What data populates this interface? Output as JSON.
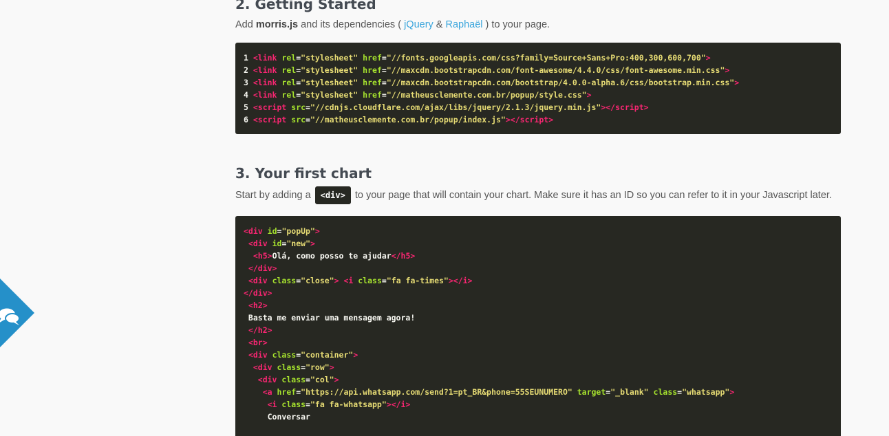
{
  "getting_started": {
    "heading": "2. Getting Started",
    "intro_pre": "Add ",
    "intro_bold": "morris.js",
    "intro_mid": " and its dependencies ( ",
    "link_jquery": "jQuery",
    "amp": " & ",
    "link_raphael": "Raphaël",
    "intro_post": " ) to your page.",
    "code_lines": [
      {
        "n": "1",
        "parts": [
          [
            "tag",
            "<link"
          ],
          [
            "txt",
            " "
          ],
          [
            "attr",
            "rel"
          ],
          [
            "txt",
            "="
          ],
          [
            "str",
            "\"stylesheet\""
          ],
          [
            "txt",
            " "
          ],
          [
            "attr",
            "href"
          ],
          [
            "txt",
            "="
          ],
          [
            "str",
            "\"//fonts.googleapis.com/css?family=Source+Sans+Pro:400,300,600,700\""
          ],
          [
            "tag",
            ">"
          ]
        ]
      },
      {
        "n": "2",
        "parts": [
          [
            "tag",
            "<link"
          ],
          [
            "txt",
            " "
          ],
          [
            "attr",
            "rel"
          ],
          [
            "txt",
            "="
          ],
          [
            "str",
            "\"stylesheet\""
          ],
          [
            "txt",
            " "
          ],
          [
            "attr",
            "href"
          ],
          [
            "txt",
            "="
          ],
          [
            "str",
            "\"//maxcdn.bootstrapcdn.com/font-awesome/4.4.0/css/font-awesome.min.css\""
          ],
          [
            "tag",
            ">"
          ]
        ]
      },
      {
        "n": "3",
        "parts": [
          [
            "tag",
            "<link"
          ],
          [
            "txt",
            " "
          ],
          [
            "attr",
            "rel"
          ],
          [
            "txt",
            "="
          ],
          [
            "str",
            "\"stylesheet\""
          ],
          [
            "txt",
            " "
          ],
          [
            "attr",
            "href"
          ],
          [
            "txt",
            "="
          ],
          [
            "str",
            "\"//maxcdn.bootstrapcdn.com/bootstrap/4.0.0-alpha.6/css/bootstrap.min.css\""
          ],
          [
            "tag",
            ">"
          ]
        ]
      },
      {
        "n": "4",
        "parts": [
          [
            "tag",
            "<link"
          ],
          [
            "txt",
            " "
          ],
          [
            "attr",
            "rel"
          ],
          [
            "txt",
            "="
          ],
          [
            "str",
            "\"stylesheet\""
          ],
          [
            "txt",
            " "
          ],
          [
            "attr",
            "href"
          ],
          [
            "txt",
            "="
          ],
          [
            "str",
            "\"//matheusclemente.com.br/popup/style.css\""
          ],
          [
            "tag",
            ">"
          ]
        ]
      },
      {
        "n": "5",
        "parts": [
          [
            "tag",
            "<script"
          ],
          [
            "txt",
            " "
          ],
          [
            "attr",
            "src"
          ],
          [
            "txt",
            "="
          ],
          [
            "str",
            "\"//cdnjs.cloudflare.com/ajax/libs/jquery/2.1.3/jquery.min.js\""
          ],
          [
            "tag",
            "></"
          ],
          [
            "tag",
            "script"
          ],
          [
            "tag",
            ">"
          ]
        ]
      },
      {
        "n": "6",
        "parts": [
          [
            "tag",
            "<script"
          ],
          [
            "txt",
            " "
          ],
          [
            "attr",
            "src"
          ],
          [
            "txt",
            "="
          ],
          [
            "str",
            "\"//matheusclemente.com.br/popup/index.js\""
          ],
          [
            "tag",
            "></"
          ],
          [
            "tag",
            "script"
          ],
          [
            "tag",
            ">"
          ]
        ]
      }
    ]
  },
  "first_chart": {
    "heading": "3. Your first chart",
    "intro_pre": "Start by adding a ",
    "inline_code": "<div>",
    "intro_post": " to your page that will contain your chart. Make sure it has an ID so you can refer to it in your Javascript later.",
    "code_lines": [
      {
        "parts": [
          [
            "tag",
            "<div"
          ],
          [
            "txt",
            " "
          ],
          [
            "attr",
            "id"
          ],
          [
            "txt",
            "="
          ],
          [
            "str",
            "\"popUp\""
          ],
          [
            "tag",
            ">"
          ]
        ]
      },
      {
        "parts": [
          [
            "txt",
            " "
          ],
          [
            "tag",
            "<div"
          ],
          [
            "txt",
            " "
          ],
          [
            "attr",
            "id"
          ],
          [
            "txt",
            "="
          ],
          [
            "str",
            "\"new\""
          ],
          [
            "tag",
            ">"
          ]
        ]
      },
      {
        "parts": [
          [
            "txt",
            "  "
          ],
          [
            "tag",
            "<h5"
          ],
          [
            "tag",
            ">"
          ],
          [
            "txt",
            "Olá, como posso te ajudar"
          ],
          [
            "tag",
            "</h5>"
          ]
        ]
      },
      {
        "parts": [
          [
            "txt",
            " "
          ],
          [
            "tag",
            "</div>"
          ]
        ]
      },
      {
        "parts": [
          [
            "txt",
            " "
          ],
          [
            "tag",
            "<div"
          ],
          [
            "txt",
            " "
          ],
          [
            "attr",
            "class"
          ],
          [
            "txt",
            "="
          ],
          [
            "str",
            "\"close\""
          ],
          [
            "tag",
            ">"
          ],
          [
            "txt",
            " "
          ],
          [
            "tag",
            "<i"
          ],
          [
            "txt",
            " "
          ],
          [
            "attr",
            "class"
          ],
          [
            "txt",
            "="
          ],
          [
            "str",
            "\"fa fa-times\""
          ],
          [
            "tag",
            "></i>"
          ]
        ]
      },
      {
        "parts": [
          [
            "tag",
            "</div>"
          ]
        ]
      },
      {
        "parts": [
          [
            "txt",
            " "
          ],
          [
            "tag",
            "<h2"
          ],
          [
            "tag",
            ">"
          ]
        ]
      },
      {
        "parts": [
          [
            "txt",
            " Basta me enviar uma mensagem agora!"
          ]
        ]
      },
      {
        "parts": [
          [
            "txt",
            " "
          ],
          [
            "tag",
            "</h2>"
          ]
        ]
      },
      {
        "parts": [
          [
            "txt",
            " "
          ],
          [
            "tag",
            "<br"
          ],
          [
            "tag",
            ">"
          ]
        ]
      },
      {
        "parts": [
          [
            "txt",
            " "
          ],
          [
            "tag",
            "<div"
          ],
          [
            "txt",
            " "
          ],
          [
            "attr",
            "class"
          ],
          [
            "txt",
            "="
          ],
          [
            "str",
            "\"container\""
          ],
          [
            "tag",
            ">"
          ]
        ]
      },
      {
        "parts": [
          [
            "txt",
            "  "
          ],
          [
            "tag",
            "<div"
          ],
          [
            "txt",
            " "
          ],
          [
            "attr",
            "class"
          ],
          [
            "txt",
            "="
          ],
          [
            "str",
            "\"row\""
          ],
          [
            "tag",
            ">"
          ]
        ]
      },
      {
        "parts": [
          [
            "txt",
            "   "
          ],
          [
            "tag",
            "<div"
          ],
          [
            "txt",
            " "
          ],
          [
            "attr",
            "class"
          ],
          [
            "txt",
            "="
          ],
          [
            "str",
            "\"col\""
          ],
          [
            "tag",
            ">"
          ]
        ]
      },
      {
        "parts": [
          [
            "txt",
            "    "
          ],
          [
            "tag",
            "<a"
          ],
          [
            "txt",
            " "
          ],
          [
            "attr",
            "href"
          ],
          [
            "txt",
            "="
          ],
          [
            "str",
            "\"https://api.whatsapp.com/send?1=pt_BR&phone=55SEUNUMERO\""
          ],
          [
            "txt",
            " "
          ],
          [
            "attr",
            "target"
          ],
          [
            "txt",
            "="
          ],
          [
            "str",
            "\"_blank\""
          ],
          [
            "txt",
            " "
          ],
          [
            "attr",
            "class"
          ],
          [
            "txt",
            "="
          ],
          [
            "str",
            "\"whatsapp\""
          ],
          [
            "tag",
            ">"
          ]
        ]
      },
      {
        "parts": [
          [
            "txt",
            "     "
          ],
          [
            "tag",
            "<i"
          ],
          [
            "txt",
            " "
          ],
          [
            "attr",
            "class"
          ],
          [
            "txt",
            "="
          ],
          [
            "str",
            "\"fa fa-whatsapp\""
          ],
          [
            "tag",
            "></i>"
          ]
        ]
      },
      {
        "parts": [
          [
            "txt",
            "     Conversar"
          ]
        ]
      }
    ]
  },
  "chat_widget": {
    "icon": "chat-bubbles-icon",
    "color": "#2590c9"
  }
}
